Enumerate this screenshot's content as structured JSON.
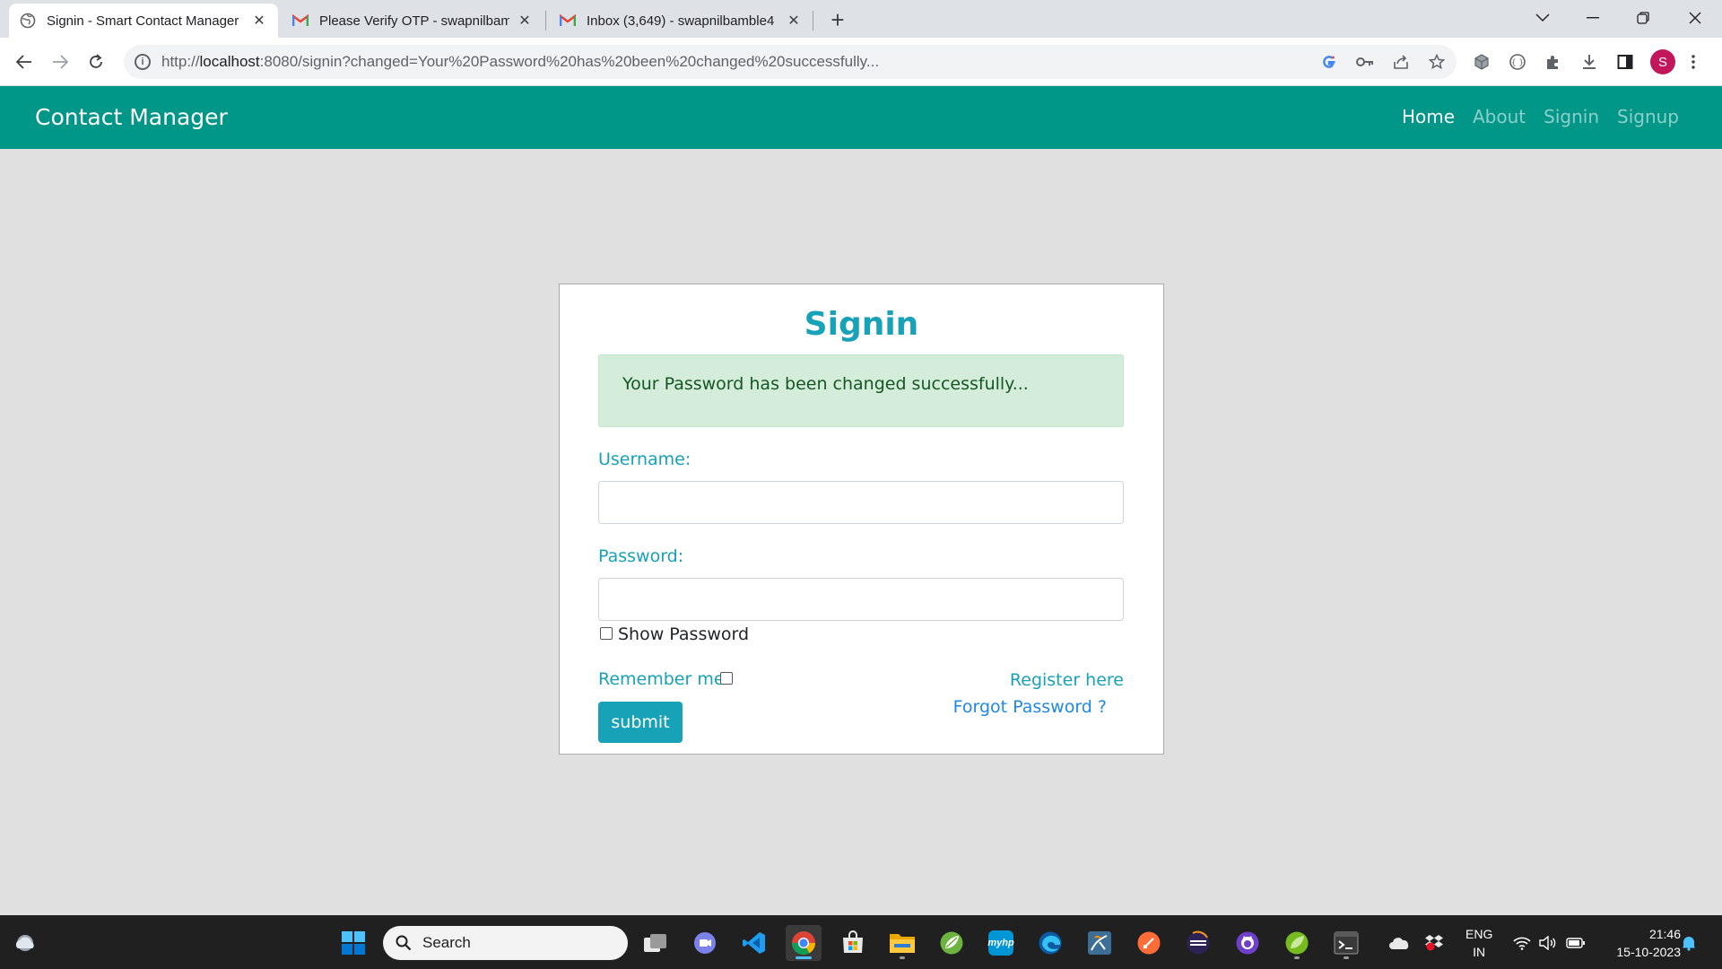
{
  "browser": {
    "tabs": [
      {
        "title": "Signin - Smart Contact Manager",
        "favicon": "globe-icon",
        "active": true
      },
      {
        "title": "Please Verify OTP - swapnilbamb",
        "favicon": "gmail-icon",
        "active": false
      },
      {
        "title": "Inbox (3,649) - swapnilbamble4",
        "favicon": "gmail-icon",
        "active": false
      }
    ],
    "url_prefix": "http://",
    "url_host": "localhost",
    "url_rest": ":8080/signin?changed=Your%20Password%20has%20been%20changed%20successfully...",
    "profile_initial": "S"
  },
  "app": {
    "brand": "Contact Manager",
    "nav": [
      {
        "label": "Home",
        "active": true
      },
      {
        "label": "About",
        "active": false
      },
      {
        "label": "Signin",
        "active": false
      },
      {
        "label": "Signup",
        "active": false
      }
    ]
  },
  "signin": {
    "title": "Signin",
    "alert": "Your Password has been changed successfully...",
    "username_label": "Username:",
    "password_label": "Password:",
    "show_password_label": "Show Password",
    "remember_label": "Remember me",
    "register_link": "Register here",
    "forgot_link": "Forgot Password ?",
    "submit_label": "submit",
    "username_value": "",
    "password_value": ""
  },
  "taskbar": {
    "search_placeholder": "Search",
    "lang_top": "ENG",
    "lang_bottom": "IN",
    "time": "21:46",
    "date": "15-10-2023"
  },
  "colors": {
    "navbar": "#009688",
    "accent": "#17a2b8",
    "alert_bg": "#d4edda",
    "alert_text": "#155724",
    "link_blue": "#1e88e5"
  }
}
